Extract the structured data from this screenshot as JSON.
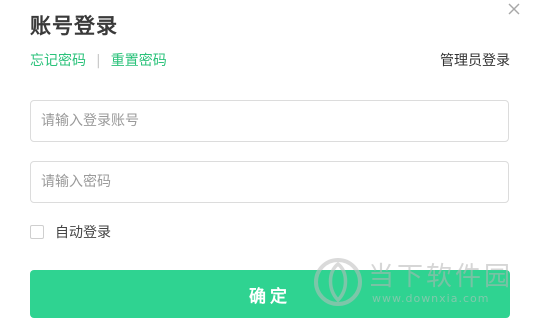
{
  "dialog": {
    "title": "账号登录",
    "close_icon": "close-icon"
  },
  "links": {
    "forgot_password": "忘记密码",
    "separator": "|",
    "reset_password": "重置密码",
    "admin_login": "管理员登录"
  },
  "form": {
    "account_placeholder": "请输入登录账号",
    "account_value": "",
    "password_placeholder": "请输入密码",
    "password_value": "",
    "remember_label": "自动登录",
    "remember_checked": false,
    "submit_label": "确定"
  },
  "watermark": {
    "logo_icon": "downxia-logo-icon",
    "text": "当下软件园",
    "url": "www.downxia.com"
  },
  "colors": {
    "accent": "#2ac27a",
    "button": "#2fd391",
    "title": "#3a3a3a",
    "border": "#dcdcdc"
  }
}
